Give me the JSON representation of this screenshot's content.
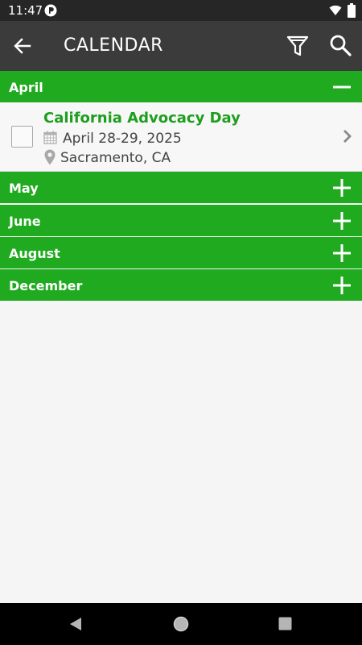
{
  "status_bar": {
    "time": "11:47",
    "icons": [
      "app-notification-icon",
      "wifi-icon",
      "battery-icon"
    ]
  },
  "app_bar": {
    "title": "CALENDAR",
    "icons": [
      "back-arrow-icon",
      "filter-icon",
      "search-icon"
    ]
  },
  "months": [
    {
      "label": "April",
      "expanded": true
    },
    {
      "label": "May",
      "expanded": false
    },
    {
      "label": "June",
      "expanded": false
    },
    {
      "label": "August",
      "expanded": false
    },
    {
      "label": "December",
      "expanded": false
    }
  ],
  "events": [
    {
      "title": "California Advocacy Day",
      "date": "April 28-29, 2025",
      "location": "Sacramento, CA",
      "checked": false
    }
  ],
  "nav_bar": {
    "icons": [
      "nav-back-icon",
      "nav-home-icon",
      "nav-recents-icon"
    ]
  },
  "colors": {
    "accent_green": "#1faa1f",
    "title_green": "#1e9e1e",
    "app_bar": "#3b3b3b",
    "status_bar": "#262626",
    "background": "#f5f5f5"
  }
}
